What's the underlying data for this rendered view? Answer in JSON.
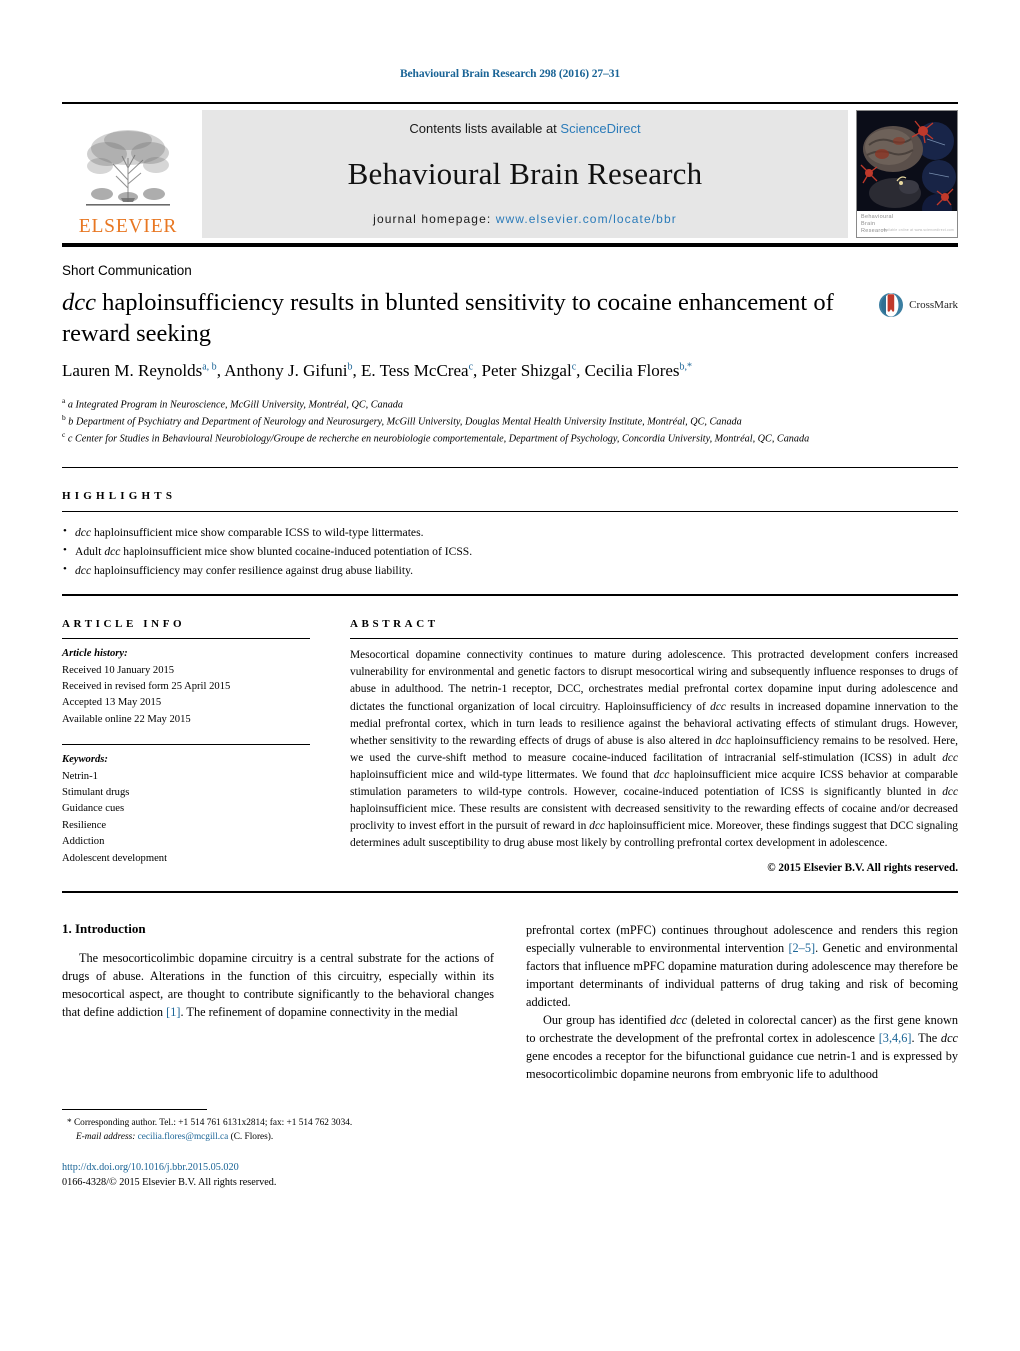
{
  "running_head": "Behavioural Brain Research 298 (2016) 27–31",
  "masthead": {
    "contents_prefix": "Contents lists available at ",
    "contents_link": "ScienceDirect",
    "journal_title": "Behavioural Brain Research",
    "homepage_prefix": "journal homepage: ",
    "homepage_url": "www.elsevier.com/locate/bbr",
    "publisher_wordmark": "ELSEVIER",
    "cover_caption_line1": "Behavioural",
    "cover_caption_line2": "Brain",
    "cover_caption_line3": "Research",
    "cover_caption_small": "available online at www.sciencedirect.com"
  },
  "article": {
    "type": "Short Communication",
    "title_part1": "dcc",
    "title_part2": " haploinsufficiency results in blunted sensitivity to cocaine enhancement of reward seeking",
    "crossmark_label": "CrossMark",
    "authors": "Lauren M. Reynolds a,b, Anthony J. Gifuni b, E. Tess McCrea c, Peter Shizgal c, Cecilia Flores b,*",
    "affiliation_a": "a Integrated Program in Neuroscience, McGill University, Montréal, QC, Canada",
    "affiliation_b": "b Department of Psychiatry and Department of Neurology and Neurosurgery, McGill University, Douglas Mental Health University Institute, Montréal, QC, Canada",
    "affiliation_c": "c Center for Studies in Behavioural Neurobiology/Groupe de recherche en neurobiologie comportementale, Department of Psychology, Concordia University, Montréal, QC, Canada"
  },
  "highlights": {
    "heading": "HIGHLIGHTS",
    "items": [
      "dcc haploinsufficient mice show comparable ICSS to wild-type littermates.",
      "Adult dcc haploinsufficient mice show blunted cocaine-induced potentiation of ICSS.",
      "dcc haploinsufficiency may confer resilience against drug abuse liability."
    ]
  },
  "article_info": {
    "heading": "ARTICLE INFO",
    "history_label": "Article history:",
    "history": [
      "Received 10 January 2015",
      "Received in revised form 25 April 2015",
      "Accepted 13 May 2015",
      "Available online 22 May 2015"
    ],
    "keywords_label": "Keywords:",
    "keywords": [
      "Netrin-1",
      "Stimulant drugs",
      "Guidance cues",
      "Resilience",
      "Addiction",
      "Adolescent development"
    ]
  },
  "abstract": {
    "heading": "ABSTRACT",
    "text": "Mesocortical dopamine connectivity continues to mature during adolescence. This protracted development confers increased vulnerability for environmental and genetic factors to disrupt mesocortical wiring and subsequently influence responses to drugs of abuse in adulthood. The netrin-1 receptor, DCC, orchestrates medial prefrontal cortex dopamine input during adolescence and dictates the functional organization of local circuitry. Haploinsufficiency of dcc results in increased dopamine innervation to the medial prefrontal cortex, which in turn leads to resilience against the behavioral activating effects of stimulant drugs. However, whether sensitivity to the rewarding effects of drugs of abuse is also altered in dcc haploinsufficiency remains to be resolved. Here, we used the curve-shift method to measure cocaine-induced facilitation of intracranial self-stimulation (ICSS) in adult dcc haploinsufficient mice and wild-type littermates. We found that dcc haploinsufficient mice acquire ICSS behavior at comparable stimulation parameters to wild-type controls. However, cocaine-induced potentiation of ICSS is significantly blunted in dcc haploinsufficient mice. These results are consistent with decreased sensitivity to the rewarding effects of cocaine and/or decreased proclivity to invest effort in the pursuit of reward in dcc haploinsufficient mice. Moreover, these findings suggest that DCC signaling determines adult susceptibility to drug abuse most likely by controlling prefrontal cortex development in adolescence.",
    "copyright": "© 2015 Elsevier B.V. All rights reserved."
  },
  "body": {
    "section_number_title": "1.  Introduction",
    "left_paragraph_1": "The mesocorticolimbic dopamine circuitry is a central substrate for the actions of drugs of abuse. Alterations in the function of this circuitry, especially within its mesocortical aspect, are thought to contribute significantly to the behavioral changes that define addiction [1]. The refinement of dopamine connectivity in the medial",
    "right_paragraph_1": "prefrontal cortex (mPFC) continues throughout adolescence and renders this region especially vulnerable to environmental intervention [2–5]. Genetic and environmental factors that influence mPFC dopamine maturation during adolescence may therefore be important determinants of individual patterns of drug taking and risk of becoming addicted.",
    "right_paragraph_2": "Our group has identified dcc (deleted in colorectal cancer) as the first gene known to orchestrate the development of the prefrontal cortex in adolescence [3,4,6]. The dcc gene encodes a receptor for the bifunctional guidance cue netrin-1 and is expressed by mesocorticolimbic dopamine neurons from embryonic life to adulthood"
  },
  "footnotes": {
    "corresponding": "* Corresponding author. Tel.: +1 514 761 6131x2814; fax: +1 514 762 3034.",
    "email_label": "E-mail address:",
    "email": "cecilia.flores@mcgill.ca",
    "email_suffix": " (C. Flores).",
    "doi": "http://dx.doi.org/10.1016/j.bbr.2015.05.020",
    "issn": "0166-4328/© 2015 Elsevier B.V. All rights reserved."
  },
  "colors": {
    "link_blue": "#1a6496",
    "sciencedirect_blue": "#2b7bb9",
    "elsevier_orange": "#E87722"
  }
}
